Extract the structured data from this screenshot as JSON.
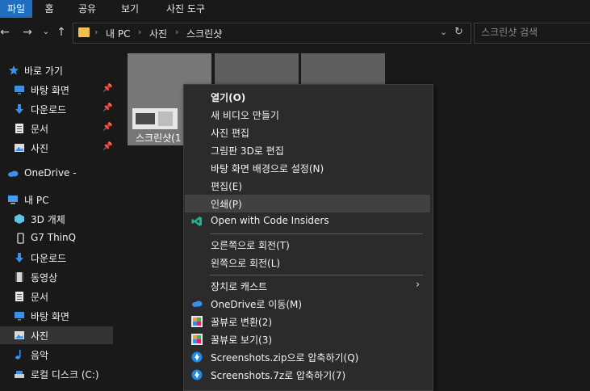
{
  "ribbon": {
    "tabs": [
      {
        "label": "파일",
        "active": true
      },
      {
        "label": "홈",
        "active": false
      },
      {
        "label": "공유",
        "active": false
      },
      {
        "label": "보기",
        "active": false
      },
      {
        "label": "사진 도구",
        "active": false
      }
    ]
  },
  "address": {
    "crumbs": [
      "내 PC",
      "사진",
      "스크린샷"
    ],
    "separator": "›",
    "search_placeholder": "스크린샷 검색"
  },
  "nav": {
    "items": [
      {
        "label": "바로 가기",
        "icon": "star-icon",
        "pinned": false
      },
      {
        "label": "바탕 화면",
        "icon": "desktop-icon",
        "pinned": true
      },
      {
        "label": "다운로드",
        "icon": "download-icon",
        "pinned": true
      },
      {
        "label": "문서",
        "icon": "document-icon",
        "pinned": true
      },
      {
        "label": "사진",
        "icon": "pictures-icon",
        "pinned": true
      },
      {
        "label": "OneDrive -",
        "icon": "onedrive-icon",
        "pinned": false
      },
      {
        "label": "내 PC",
        "icon": "pc-icon",
        "pinned": false
      },
      {
        "label": "3D 개체",
        "icon": "3d-objects-icon",
        "pinned": false
      },
      {
        "label": "G7 ThinQ",
        "icon": "phone-icon",
        "pinned": false
      },
      {
        "label": "다운로드",
        "icon": "download-icon",
        "pinned": false
      },
      {
        "label": "동영상",
        "icon": "video-icon",
        "pinned": false
      },
      {
        "label": "문서",
        "icon": "document-icon",
        "pinned": false
      },
      {
        "label": "바탕 화면",
        "icon": "desktop-icon",
        "pinned": false
      },
      {
        "label": "사진",
        "icon": "pictures-icon",
        "pinned": false,
        "selected": true
      },
      {
        "label": "음악",
        "icon": "music-icon",
        "pinned": false
      },
      {
        "label": "로컬 디스크 (C:)",
        "icon": "drive-icon",
        "pinned": false
      }
    ]
  },
  "content": {
    "thumb_name": "스크린샷(1"
  },
  "context_menu": {
    "items": [
      {
        "label": "열기(O)",
        "bold": true
      },
      {
        "label": "새 비디오 만들기"
      },
      {
        "label": "사진 편집"
      },
      {
        "label": "그림판 3D로 편집"
      },
      {
        "label": "바탕 화면 배경으로 설정(N)"
      },
      {
        "label": "편집(E)"
      },
      {
        "label": "인쇄(P)",
        "highlighted": true
      },
      {
        "label": "Open with Code Insiders",
        "icon": "vscode-insiders-icon"
      },
      {
        "label": "오른쪽으로 회전(T)"
      },
      {
        "label": "왼쪽으로 회전(L)"
      },
      {
        "label": "장치로 캐스트",
        "submenu": true
      },
      {
        "label": "OneDrive로 이동(M)",
        "icon": "onedrive-icon"
      },
      {
        "label": "꿀뷰로 변환(2)",
        "icon": "honeyview-icon"
      },
      {
        "label": "꿀뷰로 보기(3)",
        "icon": "honeyview-icon"
      },
      {
        "label": "Screenshots.zip으로 압축하기(Q)",
        "icon": "bandizip-icon"
      },
      {
        "label": "Screenshots.7z로 압축하기(7)",
        "icon": "bandizip-icon"
      }
    ]
  },
  "colors": {
    "background": "#191919",
    "active_tab": "#1f6ec0",
    "menu_background": "#2b2b2b",
    "menu_highlight": "#414141",
    "folder": "#f3c14b",
    "accent_blue": "#3b8eea"
  }
}
